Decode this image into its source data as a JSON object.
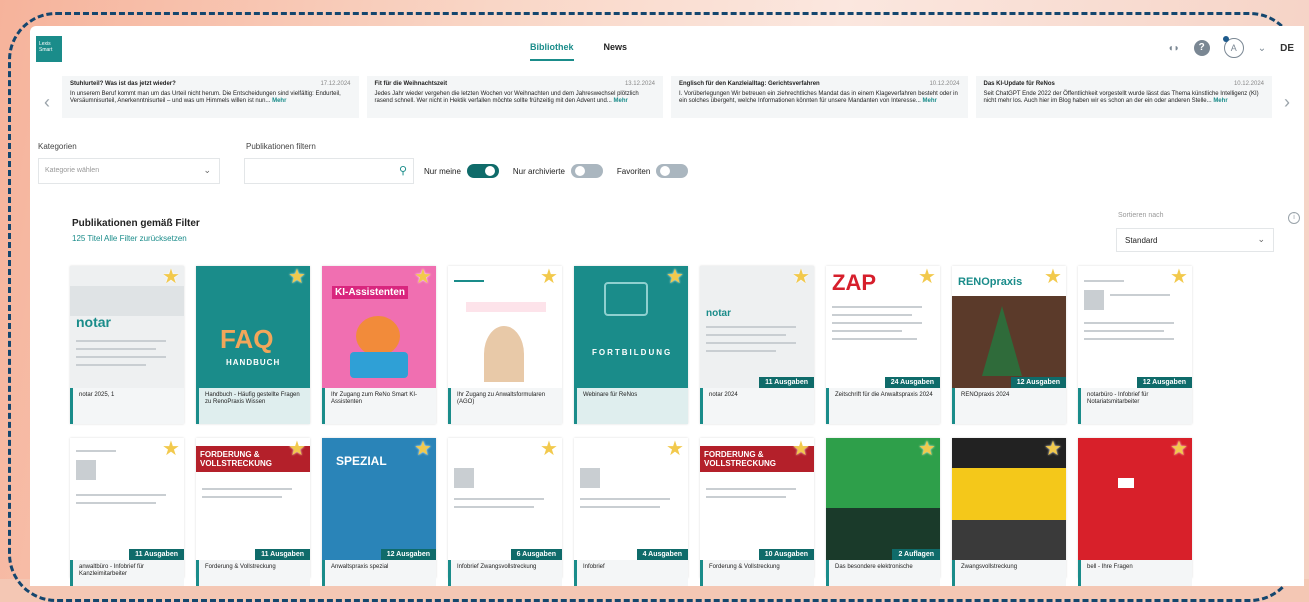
{
  "header": {
    "logo_text": "Lexis Smart",
    "tabs": [
      {
        "label": "Bibliothek",
        "active": true
      },
      {
        "label": "News",
        "active": false
      }
    ],
    "language": "DE",
    "user_initial": "A",
    "icons": [
      "notification-icon",
      "help-icon",
      "user-icon"
    ]
  },
  "news": [
    {
      "title": "Stuhlurteil? Was ist das jetzt wieder?",
      "date": "17.12.2024",
      "text": "In unserem Beruf kommt man um das Urteil nicht herum. Die Entscheidungen sind vielfältig: Endurteil, Versäumnisurteil, Anerkenntnisurteil – und was um Himmels willen ist nun...",
      "more": "Mehr"
    },
    {
      "title": "Fit für die Weihnachtszeit",
      "date": "13.12.2024",
      "text": "Jedes Jahr wieder vergehen die letzten Wochen vor Weihnachten und dem Jahreswechsel plötzlich rasend schnell. Wer nicht in Hektik verfallen möchte sollte frühzeitig mit den Advent und...",
      "more": "Mehr"
    },
    {
      "title": "Englisch für den Kanzleialltag: Gerichtsverfahren",
      "date": "10.12.2024",
      "text": "I. Vorüberlegungen Wir betreuen ein ziehrechtliches Mandat das in einem Klageverfahren besteht oder in ein solches übergeht, welche Informationen könnten für unsere Mandanten von Interesse...",
      "more": "Mehr"
    },
    {
      "title": "Das KI-Update für ReNos",
      "date": "10.12.2024",
      "text": "Seit ChatGPT Ende 2022 der Öffentlichkeit vorgestellt wurde lässt das Thema künstliche Intelligenz (KI) nicht mehr los. Auch hier im Blog haben wir es schon an der ein oder anderen Stelle...",
      "more": "Mehr"
    }
  ],
  "filters": {
    "category_label": "Kategorien",
    "category_placeholder": "Kategorie wählen",
    "filter_label": "Publikationen filtern",
    "toggles": [
      {
        "label": "Nur meine",
        "on": true
      },
      {
        "label": "Nur archivierte",
        "on": false
      },
      {
        "label": "Favoriten",
        "on": false
      }
    ]
  },
  "results": {
    "title": "Publikationen gemäß Filter",
    "count": "125 Titel",
    "reset": "Alle Filter zurücksetzen",
    "sort_label": "Sortieren nach",
    "sort_value": "Standard"
  },
  "cards_row1": [
    {
      "title": "notar 2025, 1",
      "badge": "",
      "cover": "notar"
    },
    {
      "title": "Handbuch - Häufig gestellte Fragen zu RenoPraxis Wissen",
      "badge": "",
      "cover": "faq",
      "cover_text": "FAQ",
      "cover_sub": "HANDBUCH"
    },
    {
      "title": "Ihr Zugang zum ReNo Smart KI-Assistenten",
      "badge": "",
      "cover": "ki",
      "cover_text": "KI-Assistenten"
    },
    {
      "title": "Ihr Zugang zu Anwaltsformularen (AGO)",
      "badge": "",
      "cover": "ago"
    },
    {
      "title": "Webinare für ReNos",
      "badge": "",
      "cover": "fortbildung",
      "cover_text": "FORTBILDUNG"
    },
    {
      "title": "notar 2024",
      "badge": "11 Ausgaben",
      "cover": "notar"
    },
    {
      "title": "Zeitschrift für die Anwaltspraxis 2024",
      "badge": "24 Ausgaben",
      "cover": "zap",
      "cover_text": "ZAP"
    },
    {
      "title": "RENOpraxis 2024",
      "badge": "12 Ausgaben",
      "cover": "renopraxis",
      "cover_text": "RENOpraxis"
    },
    {
      "title": "notarbüro - Infobrief für Notariatsmitarbeiter",
      "badge": "12 Ausgaben",
      "cover": "doc"
    }
  ],
  "cards_row2": [
    {
      "title": "anwaltbüro - Infobrief für Kanzleimitarbeiter",
      "badge": "11 Ausgaben",
      "cover": "doc"
    },
    {
      "title": "Forderung & Vollstreckung",
      "badge": "11 Ausgaben",
      "cover": "fv",
      "cover_text": "FORDERUNG & VOLLSTRECKUNG"
    },
    {
      "title": "Anwaltspraxis spezial",
      "badge": "12 Ausgaben",
      "cover": "spezial",
      "cover_text": "SPEZIAL"
    },
    {
      "title": "Infobrief Zwangsvollstreckung",
      "badge": "6 Ausgaben",
      "cover": "doc"
    },
    {
      "title": "Infobrief",
      "badge": "4 Ausgaben",
      "cover": "doc"
    },
    {
      "title": "Forderung & Vollstreckung",
      "badge": "10 Ausgaben",
      "cover": "fv",
      "cover_text": "FORDERUNG & VOLLSTRECKUNG"
    },
    {
      "title": "Das besondere elektronische",
      "badge": "2 Auflagen",
      "cover": "green"
    },
    {
      "title": "Zwangsvollstreckung",
      "badge": "",
      "cover": "yellow"
    },
    {
      "title": "bell - Ihre Fragen",
      "badge": "",
      "cover": "red"
    }
  ]
}
